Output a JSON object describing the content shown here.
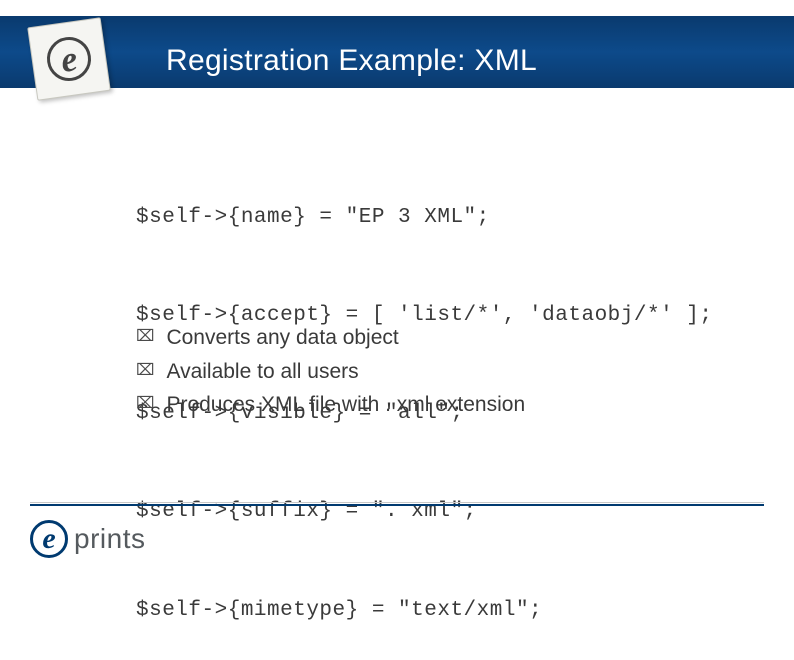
{
  "title": "Registration Example: XML",
  "code": [
    "$self->{name} = \"EP 3 XML\";",
    "$self->{accept} = [ 'list/*', 'dataobj/*' ];",
    "$self->{visible} = \"all\";",
    "$self->{suffix} = \". xml\";",
    "$self->{mimetype} = \"text/xml\";"
  ],
  "bullets": [
    "Converts any data object",
    "Available to all users",
    "Produces XML file with . xml extension"
  ],
  "footer_logo_text": "prints",
  "logo_letter": "e"
}
